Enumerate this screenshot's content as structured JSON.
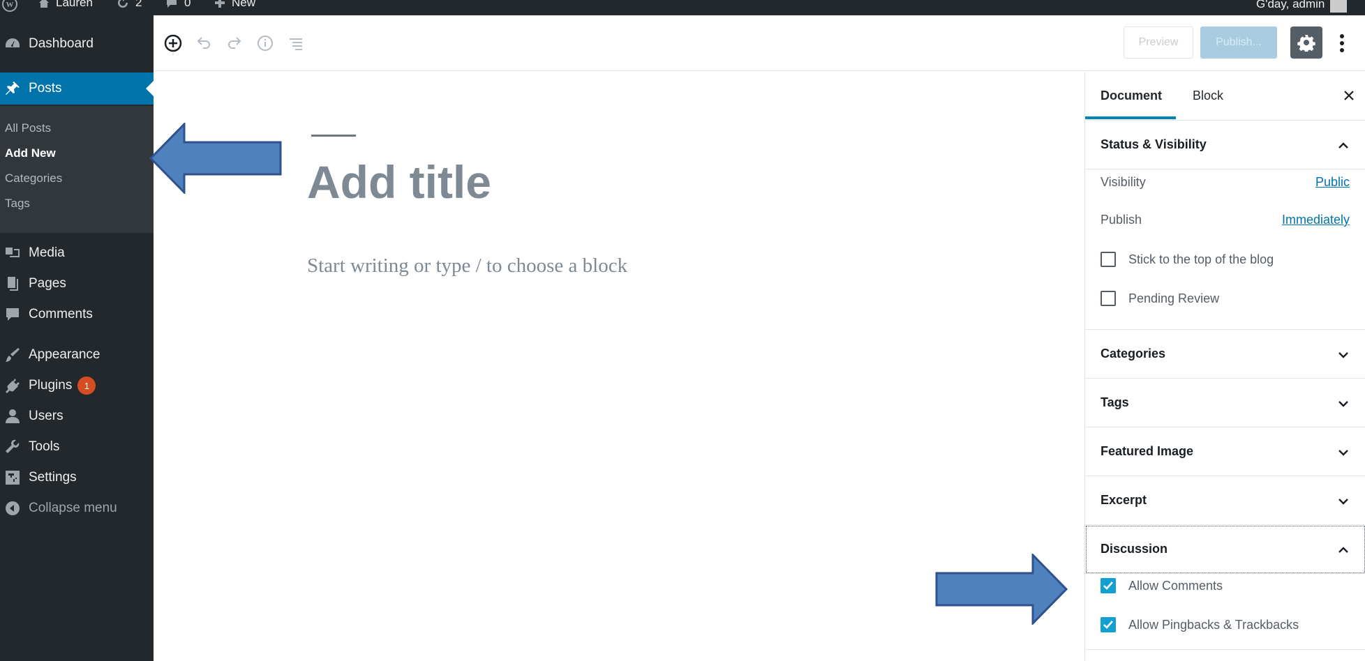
{
  "adminbar": {
    "site_name": "Lauren",
    "updates_count": "2",
    "comments_count": "0",
    "new_label": "New",
    "greeting": "G'day, admin"
  },
  "sidebar": {
    "items": [
      {
        "label": "Dashboard",
        "icon": "dashboard-icon"
      },
      {
        "label": "Posts",
        "icon": "pin-icon"
      },
      {
        "label": "Media",
        "icon": "media-icon"
      },
      {
        "label": "Pages",
        "icon": "pages-icon"
      },
      {
        "label": "Comments",
        "icon": "comment-icon"
      },
      {
        "label": "Appearance",
        "icon": "brush-icon"
      },
      {
        "label": "Plugins",
        "icon": "plug-icon",
        "badge": "1"
      },
      {
        "label": "Users",
        "icon": "user-icon"
      },
      {
        "label": "Tools",
        "icon": "wrench-icon"
      },
      {
        "label": "Settings",
        "icon": "settings-icon"
      },
      {
        "label": "Collapse menu",
        "icon": "collapse-icon"
      }
    ],
    "posts_submenu": [
      "All Posts",
      "Add New",
      "Categories",
      "Tags"
    ],
    "active_item": "Posts",
    "current_subitem": "Add New"
  },
  "toolbar": {
    "preview_label": "Preview",
    "publish_label": "Publish...",
    "icons": [
      "add-block-icon",
      "undo-icon",
      "redo-icon",
      "info-icon",
      "outline-icon",
      "settings-gear-icon",
      "more-vertical-icon"
    ]
  },
  "editor": {
    "title_placeholder": "Add title",
    "body_placeholder": "Start writing or type / to choose a block"
  },
  "settings_sidebar": {
    "tabs": [
      "Document",
      "Block"
    ],
    "active_tab": "Document",
    "status_visibility": {
      "title": "Status & Visibility",
      "visibility_label": "Visibility",
      "visibility_value": "Public",
      "publish_label": "Publish",
      "publish_value": "Immediately",
      "sticky_label": "Stick to the top of the blog",
      "sticky_checked": false,
      "pending_label": "Pending Review",
      "pending_checked": false
    },
    "panels": [
      "Categories",
      "Tags",
      "Featured Image",
      "Excerpt"
    ],
    "discussion": {
      "title": "Discussion",
      "allow_comments_label": "Allow Comments",
      "allow_comments_checked": true,
      "allow_pingbacks_label": "Allow Pingbacks & Trackbacks",
      "allow_pingbacks_checked": true
    }
  },
  "colors": {
    "admin_dark": "#23282d",
    "active_blue": "#0073aa",
    "checkbox_blue": "#11a0d2",
    "annotation_arrow": "#4a7ab8"
  }
}
